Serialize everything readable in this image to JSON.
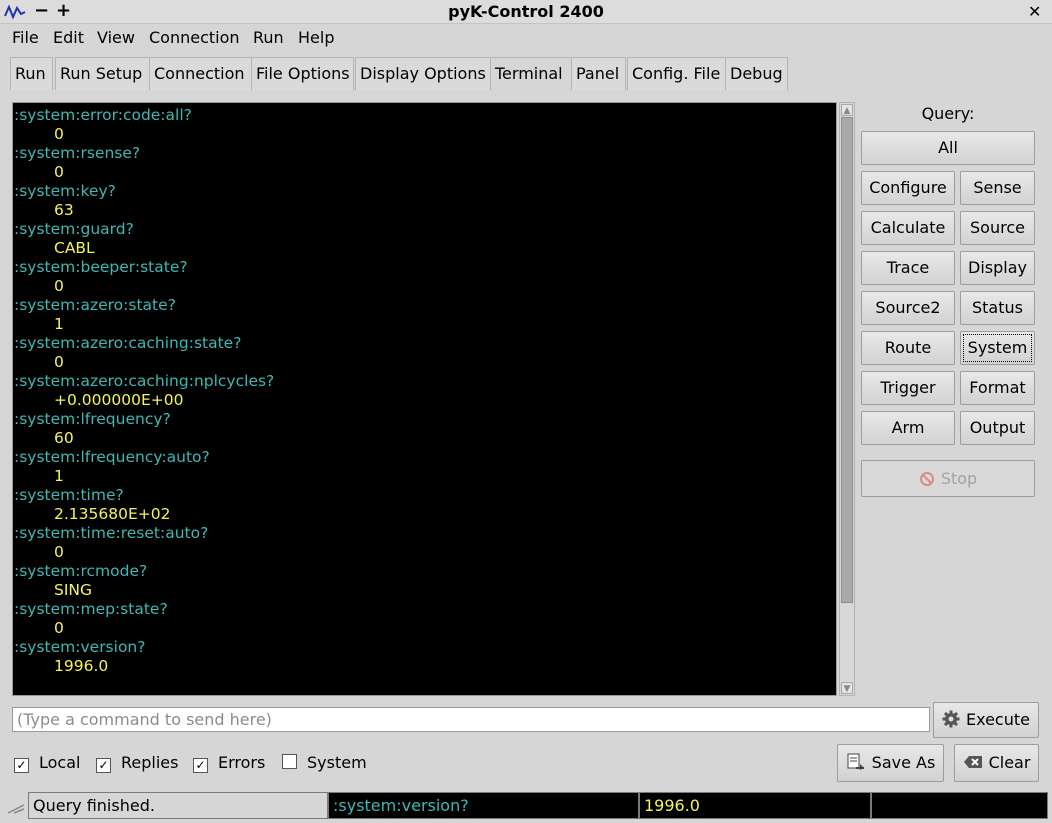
{
  "window": {
    "title": "pyK-Control 2400"
  },
  "menu": [
    "File",
    "Edit",
    "View",
    "Connection",
    "Run",
    "Help"
  ],
  "tabs": [
    "Run",
    "Run Setup",
    "Connection",
    "File Options",
    "Display Options",
    "Terminal",
    "Panel",
    "Config. File",
    "Debug"
  ],
  "terminal": [
    {
      "cmd": ":system:error:code:all?",
      "reply": "0"
    },
    {
      "cmd": ":system:rsense?",
      "reply": "0"
    },
    {
      "cmd": ":system:key?",
      "reply": "63"
    },
    {
      "cmd": ":system:guard?",
      "reply": "CABL"
    },
    {
      "cmd": ":system:beeper:state?",
      "reply": "0"
    },
    {
      "cmd": ":system:azero:state?",
      "reply": "1"
    },
    {
      "cmd": ":system:azero:caching:state?",
      "reply": "0"
    },
    {
      "cmd": ":system:azero:caching:nplcycles?",
      "reply": "+0.000000E+00"
    },
    {
      "cmd": ":system:lfrequency?",
      "reply": "60"
    },
    {
      "cmd": ":system:lfrequency:auto?",
      "reply": "1"
    },
    {
      "cmd": ":system:time?",
      "reply": "2.135680E+02"
    },
    {
      "cmd": ":system:time:reset:auto?",
      "reply": "0"
    },
    {
      "cmd": ":system:rcmode?",
      "reply": "SING"
    },
    {
      "cmd": ":system:mep:state?",
      "reply": "0"
    },
    {
      "cmd": ":system:version?",
      "reply": "1996.0"
    }
  ],
  "query": {
    "label": "Query:",
    "all": "All",
    "buttons": [
      "Configure",
      "Sense",
      "Calculate",
      "Source",
      "Trace",
      "Display",
      "Source2",
      "Status",
      "Route",
      "System",
      "Trigger",
      "Format",
      "Arm",
      "Output"
    ],
    "stop": "Stop"
  },
  "command": {
    "placeholder": "(Type a command to send here)",
    "execute": "Execute"
  },
  "filters": [
    {
      "label": "Local",
      "checked": true
    },
    {
      "label": "Replies",
      "checked": true
    },
    {
      "label": "Errors",
      "checked": true
    },
    {
      "label": "System",
      "checked": false
    }
  ],
  "actions": {
    "save_as": "Save As",
    "clear": "Clear"
  },
  "status": {
    "message": "Query finished.",
    "last_command": ":system:version?",
    "last_reply": "1996.0"
  },
  "colors": {
    "command": "#3fb7b3",
    "reply": "#f4f45a",
    "terminal_bg": "#000000"
  }
}
